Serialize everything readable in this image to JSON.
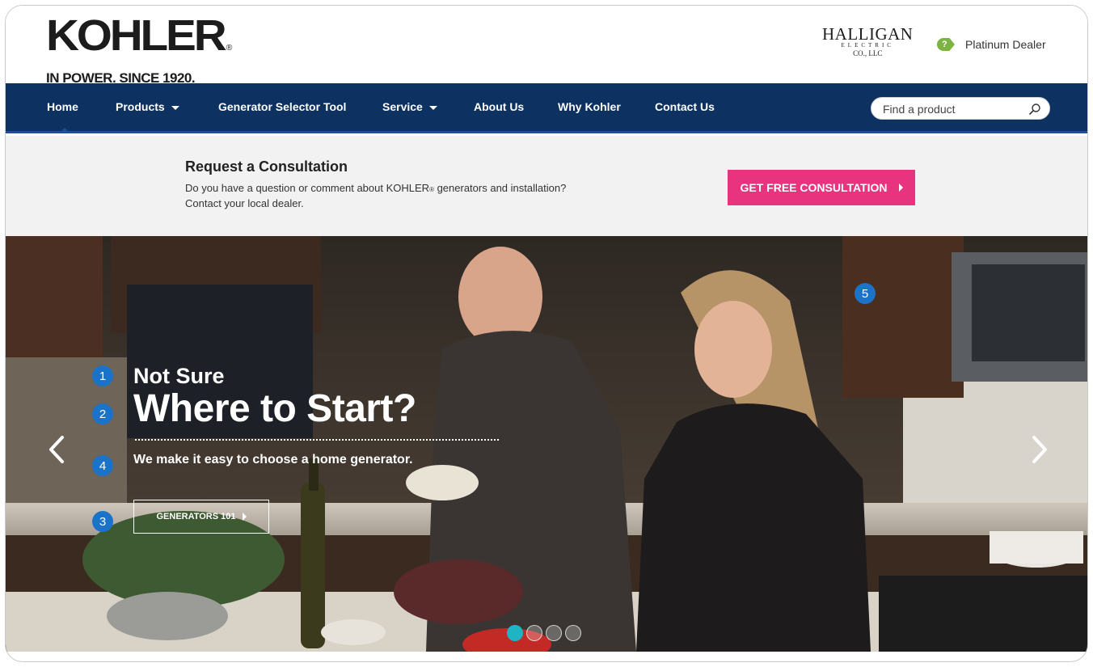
{
  "brand": {
    "name": "KOHLER",
    "registered": "®",
    "tagline": "IN POWER. SINCE 1920."
  },
  "dealer": {
    "logo_name": "HALLIGAN",
    "logo_sub": "ELECTRIC",
    "logo_sub2": "CO., LLC",
    "badge_icon": "?",
    "badge_label": "Platinum Dealer"
  },
  "nav": {
    "items": [
      {
        "label": "Home"
      },
      {
        "label": "Products"
      },
      {
        "label": "Generator Selector Tool"
      },
      {
        "label": "Service"
      },
      {
        "label": "About Us"
      },
      {
        "label": "Why Kohler"
      },
      {
        "label": "Contact Us"
      }
    ],
    "search_placeholder": "Find a product"
  },
  "consultation": {
    "title": "Request a Consultation",
    "text_part1": "Do you have a question or comment about KOHLER",
    "text_reg": "®",
    "text_part2": " generators and installation?",
    "text_line2": "Contact your local dealer.",
    "button_label": "GET FREE CONSULTATION"
  },
  "hero": {
    "line1": "Not Sure",
    "line2": "Where to Start?",
    "line3": "We make it easy to choose a home generator.",
    "button_label": "GENERATORS 101",
    "markers": [
      "1",
      "2",
      "3",
      "4",
      "5"
    ],
    "slide_count": 4,
    "active_slide": 1
  },
  "colors": {
    "nav_bg": "#0d3161",
    "cta": "#e8347f",
    "marker": "#1a73c9",
    "active_dot": "#1fb4c4",
    "dealer_badge": "#7cb342"
  },
  "icons": {
    "search": "search-icon",
    "prev": "chevron-left-icon",
    "next": "chevron-right-icon"
  }
}
